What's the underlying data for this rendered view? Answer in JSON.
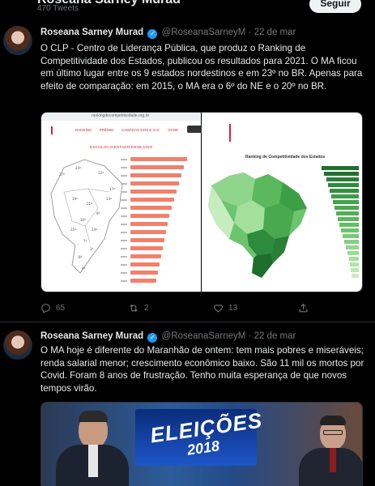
{
  "header": {
    "name": "Roseana Sarney Murad",
    "tweet_count": "470 Tweets",
    "follow_label": "Seguir"
  },
  "tweets": [
    {
      "name": "Roseana Sarney Murad",
      "handle": "@RoseanaSarneyM",
      "separator": "·",
      "date": "22 de mar",
      "text": "O CLP - Centro de Liderança Pública, que produz o Ranking de Competitividade dos Estados, publicou os resultados para 2021. O MA ficou em último lugar entre os 9 estados nordestinos e em 23º no BR. Apenas para efeito de comparação: em 2015, o MA era o 6º do NE e o 20º no BR.",
      "media": {
        "left": {
          "url": "rankingdecompetitividade.org.br",
          "nav": [
            "RANKING",
            "PRÊMIO",
            "CAMADAS DOS E.O.D.",
            "OCDE"
          ],
          "section_title": "ESCOLHA O ESTADO DESEJADO"
        },
        "right": {
          "chart_title": "Ranking de Competitividade dos Estados"
        }
      },
      "replies": "65",
      "retweets": "2",
      "likes": "13"
    },
    {
      "name": "Roseana Sarney Murad",
      "handle": "@RoseanaSarneyM",
      "separator": "·",
      "date": "22 de mar",
      "text": "O MA hoje é diferente do Maranhão de ontem: tem mais pobres e miseráveis; renda salarial menor; crescimento econômico baixo. São 11 mil os mortos por Covid. Foram 8 anos de frustração. Tenho muita esperança de que novos tempos virão.",
      "media": {
        "banner": "ELEIÇÕES",
        "year": "2018"
      }
    }
  ],
  "colors": {
    "accent": "#1d9bf0",
    "muted": "#71767b",
    "bar": "#f2806a",
    "map_green": "#2e8b3d"
  }
}
